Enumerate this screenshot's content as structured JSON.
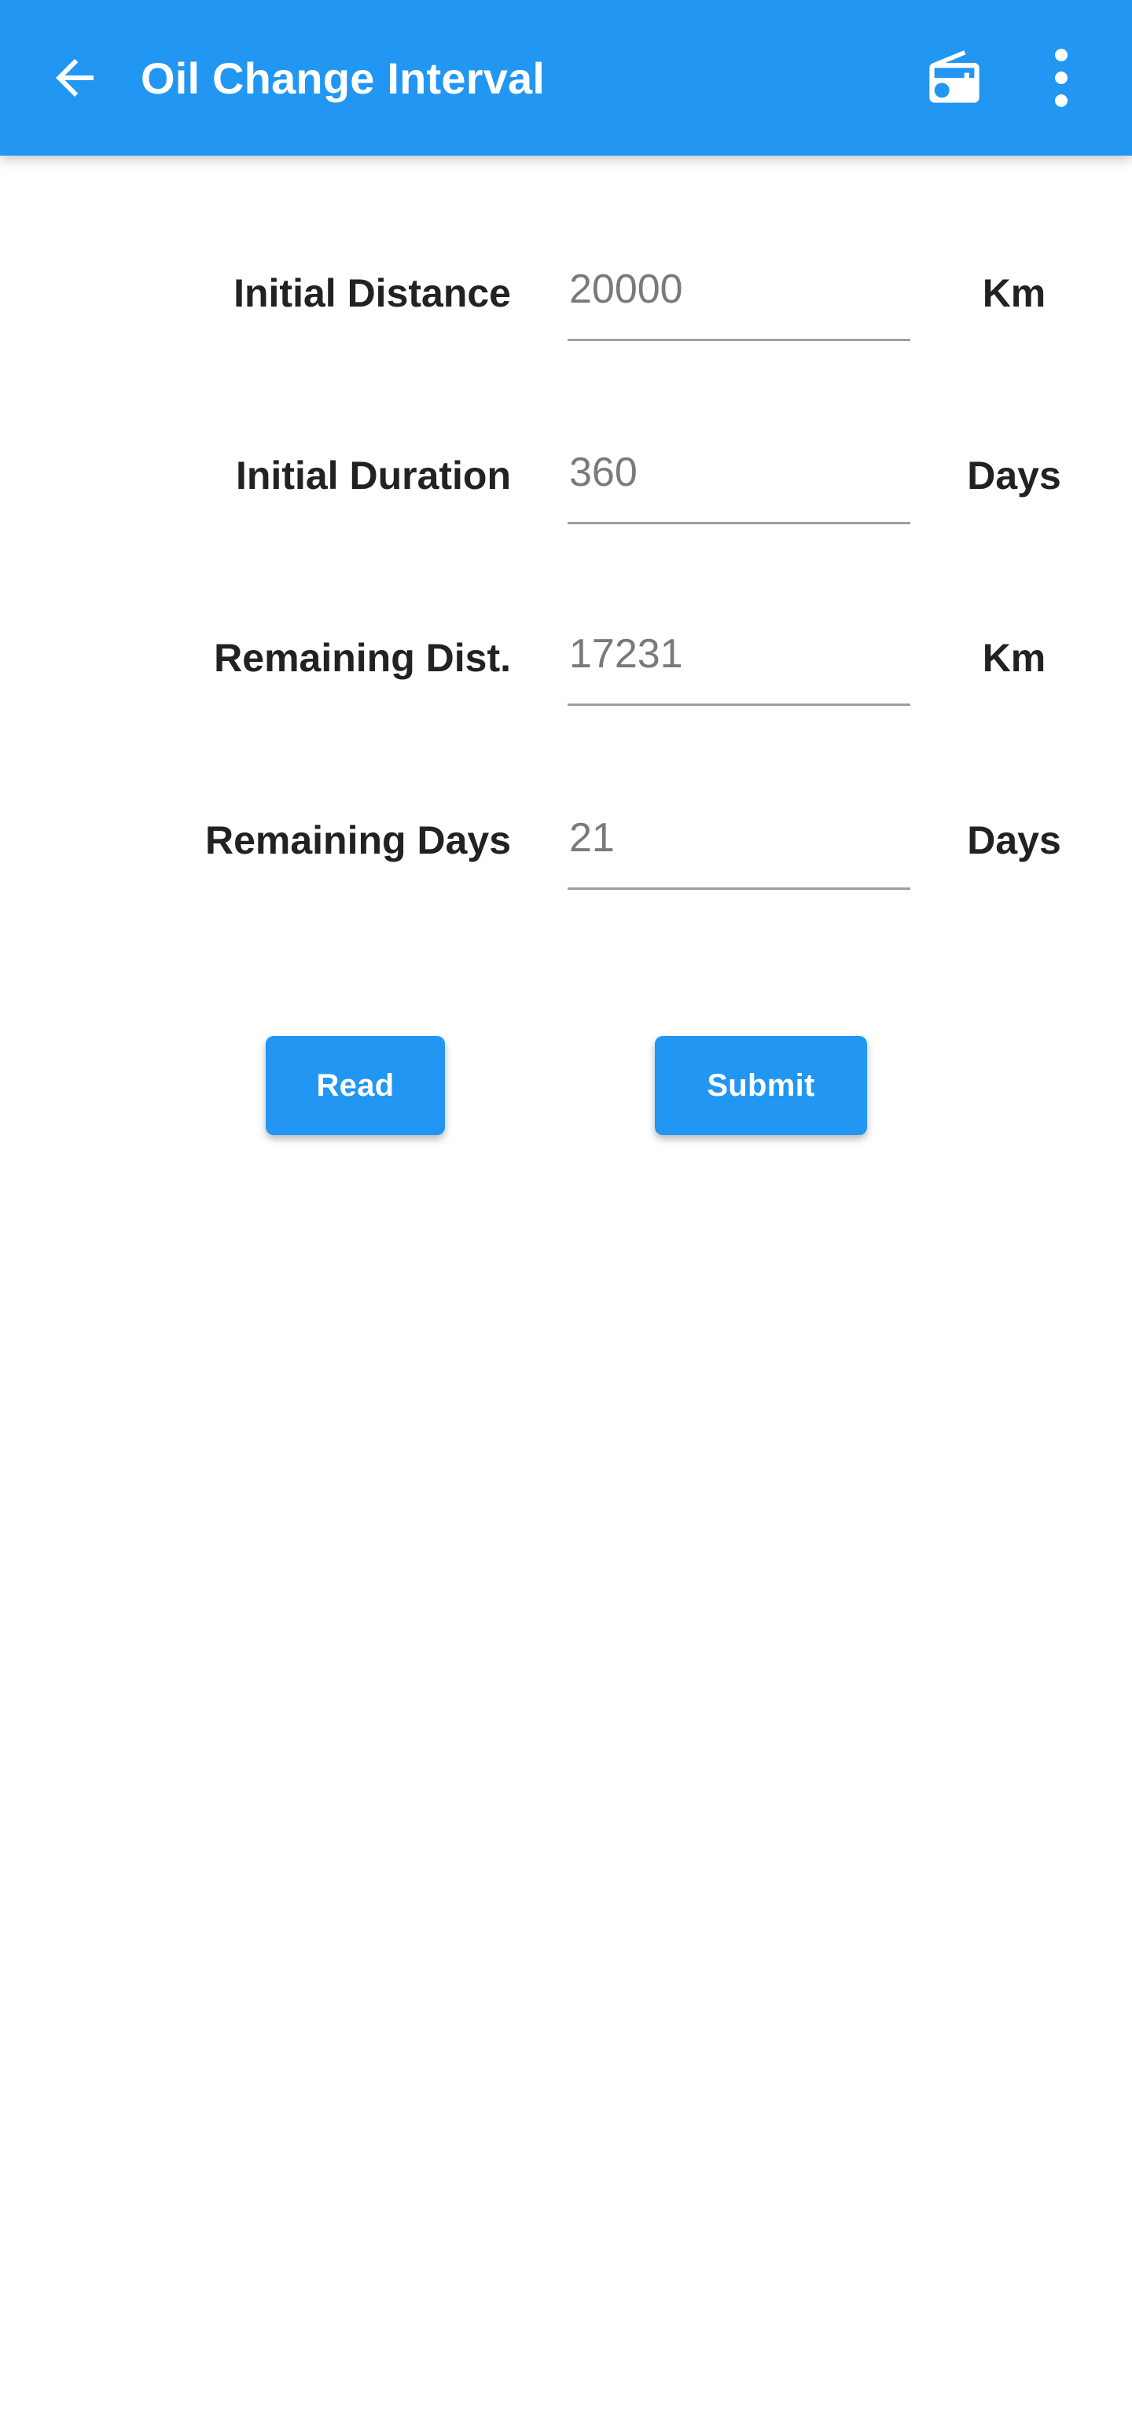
{
  "toolbar": {
    "back_icon": "arrow-back-icon",
    "title": "Oil Change Interval",
    "radio_icon": "radio-icon",
    "overflow_icon": "more-vert-icon",
    "background_color": "#2196f3",
    "text_color": "#ffffff"
  },
  "form": {
    "rows": [
      {
        "label": "Initial Distance",
        "value": "20000",
        "placeholder": "20000",
        "unit": "Km"
      },
      {
        "label": "Initial Duration",
        "value": "360",
        "placeholder": "360",
        "unit": "Days"
      },
      {
        "label": "Remaining Dist.",
        "value": "17231",
        "placeholder": "17231",
        "unit": "Km"
      },
      {
        "label": "Remaining Days",
        "value": "21",
        "placeholder": "21",
        "unit": "Days"
      }
    ]
  },
  "buttons": {
    "read_label": "Read",
    "submit_label": "Submit",
    "accent_color": "#2196f3"
  }
}
